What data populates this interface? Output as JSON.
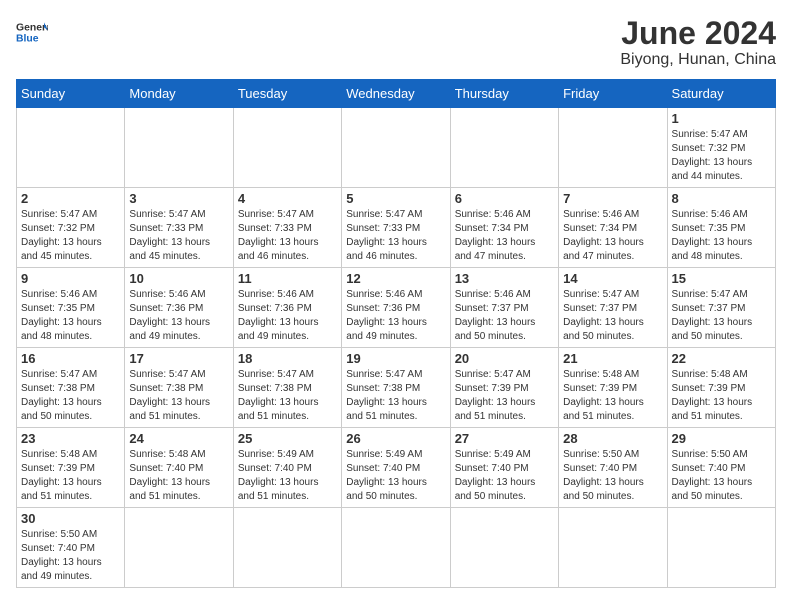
{
  "header": {
    "logo_general": "General",
    "logo_blue": "Blue",
    "month_title": "June 2024",
    "location": "Biyong, Hunan, China"
  },
  "weekdays": [
    "Sunday",
    "Monday",
    "Tuesday",
    "Wednesday",
    "Thursday",
    "Friday",
    "Saturday"
  ],
  "days": {
    "1": {
      "sunrise": "5:47 AM",
      "sunset": "7:32 PM",
      "daylight": "13 hours and 44 minutes."
    },
    "2": {
      "sunrise": "5:47 AM",
      "sunset": "7:32 PM",
      "daylight": "13 hours and 45 minutes."
    },
    "3": {
      "sunrise": "5:47 AM",
      "sunset": "7:33 PM",
      "daylight": "13 hours and 45 minutes."
    },
    "4": {
      "sunrise": "5:47 AM",
      "sunset": "7:33 PM",
      "daylight": "13 hours and 46 minutes."
    },
    "5": {
      "sunrise": "5:47 AM",
      "sunset": "7:33 PM",
      "daylight": "13 hours and 46 minutes."
    },
    "6": {
      "sunrise": "5:46 AM",
      "sunset": "7:34 PM",
      "daylight": "13 hours and 47 minutes."
    },
    "7": {
      "sunrise": "5:46 AM",
      "sunset": "7:34 PM",
      "daylight": "13 hours and 47 minutes."
    },
    "8": {
      "sunrise": "5:46 AM",
      "sunset": "7:35 PM",
      "daylight": "13 hours and 48 minutes."
    },
    "9": {
      "sunrise": "5:46 AM",
      "sunset": "7:35 PM",
      "daylight": "13 hours and 48 minutes."
    },
    "10": {
      "sunrise": "5:46 AM",
      "sunset": "7:36 PM",
      "daylight": "13 hours and 49 minutes."
    },
    "11": {
      "sunrise": "5:46 AM",
      "sunset": "7:36 PM",
      "daylight": "13 hours and 49 minutes."
    },
    "12": {
      "sunrise": "5:46 AM",
      "sunset": "7:36 PM",
      "daylight": "13 hours and 49 minutes."
    },
    "13": {
      "sunrise": "5:46 AM",
      "sunset": "7:37 PM",
      "daylight": "13 hours and 50 minutes."
    },
    "14": {
      "sunrise": "5:47 AM",
      "sunset": "7:37 PM",
      "daylight": "13 hours and 50 minutes."
    },
    "15": {
      "sunrise": "5:47 AM",
      "sunset": "7:37 PM",
      "daylight": "13 hours and 50 minutes."
    },
    "16": {
      "sunrise": "5:47 AM",
      "sunset": "7:38 PM",
      "daylight": "13 hours and 50 minutes."
    },
    "17": {
      "sunrise": "5:47 AM",
      "sunset": "7:38 PM",
      "daylight": "13 hours and 51 minutes."
    },
    "18": {
      "sunrise": "5:47 AM",
      "sunset": "7:38 PM",
      "daylight": "13 hours and 51 minutes."
    },
    "19": {
      "sunrise": "5:47 AM",
      "sunset": "7:38 PM",
      "daylight": "13 hours and 51 minutes."
    },
    "20": {
      "sunrise": "5:47 AM",
      "sunset": "7:39 PM",
      "daylight": "13 hours and 51 minutes."
    },
    "21": {
      "sunrise": "5:48 AM",
      "sunset": "7:39 PM",
      "daylight": "13 hours and 51 minutes."
    },
    "22": {
      "sunrise": "5:48 AM",
      "sunset": "7:39 PM",
      "daylight": "13 hours and 51 minutes."
    },
    "23": {
      "sunrise": "5:48 AM",
      "sunset": "7:39 PM",
      "daylight": "13 hours and 51 minutes."
    },
    "24": {
      "sunrise": "5:48 AM",
      "sunset": "7:40 PM",
      "daylight": "13 hours and 51 minutes."
    },
    "25": {
      "sunrise": "5:49 AM",
      "sunset": "7:40 PM",
      "daylight": "13 hours and 51 minutes."
    },
    "26": {
      "sunrise": "5:49 AM",
      "sunset": "7:40 PM",
      "daylight": "13 hours and 50 minutes."
    },
    "27": {
      "sunrise": "5:49 AM",
      "sunset": "7:40 PM",
      "daylight": "13 hours and 50 minutes."
    },
    "28": {
      "sunrise": "5:50 AM",
      "sunset": "7:40 PM",
      "daylight": "13 hours and 50 minutes."
    },
    "29": {
      "sunrise": "5:50 AM",
      "sunset": "7:40 PM",
      "daylight": "13 hours and 50 minutes."
    },
    "30": {
      "sunrise": "5:50 AM",
      "sunset": "7:40 PM",
      "daylight": "13 hours and 49 minutes."
    }
  }
}
